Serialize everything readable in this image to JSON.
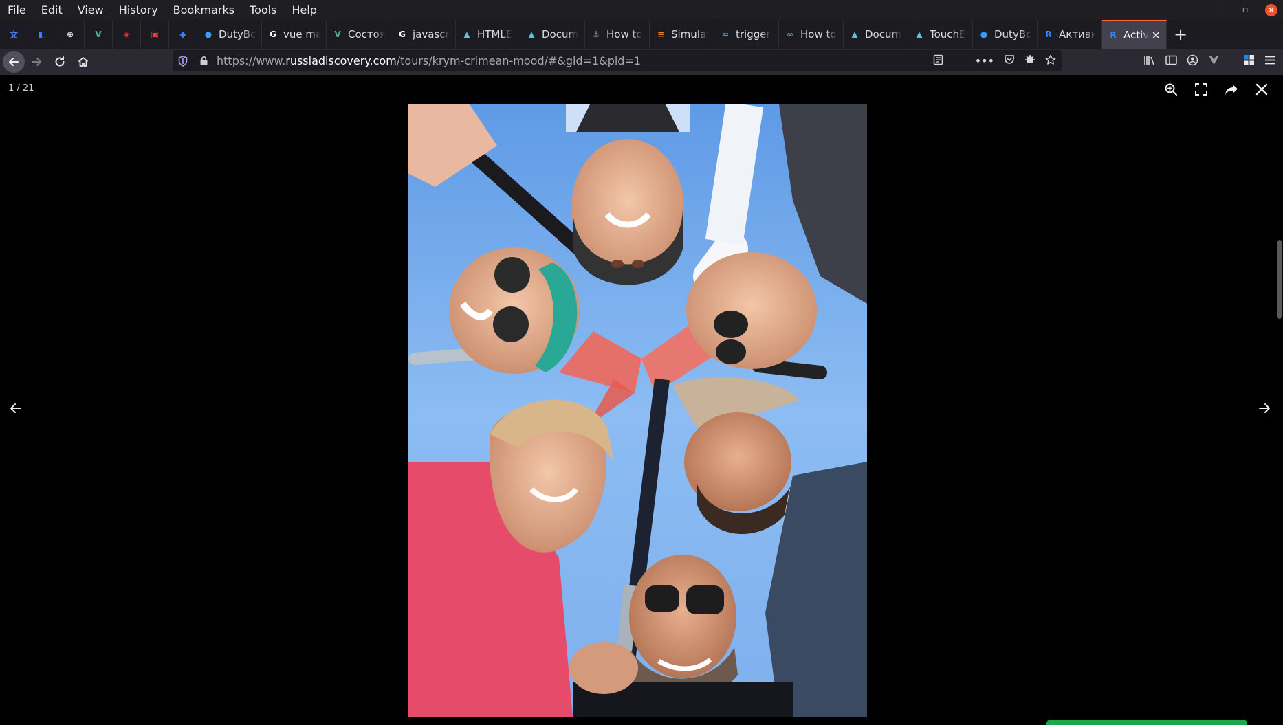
{
  "menu": [
    "File",
    "Edit",
    "View",
    "History",
    "Bookmarks",
    "Tools",
    "Help"
  ],
  "tabs": [
    {
      "type": "pinned",
      "icon": "translate-icon",
      "color": "#4a7fe0"
    },
    {
      "type": "pinned",
      "icon": "bitwarden-icon",
      "color": "#3b82f6"
    },
    {
      "type": "pinned",
      "icon": "globe-icon",
      "color": "#e8e8e8"
    },
    {
      "type": "pinned",
      "icon": "vue-icon",
      "color": "#42b883"
    },
    {
      "type": "pinned",
      "icon": "laravel-icon",
      "color": "#e3342f"
    },
    {
      "type": "pinned",
      "icon": "todoist-icon",
      "color": "#e44332"
    },
    {
      "type": "pinned",
      "icon": "jira-icon",
      "color": "#2684ff"
    },
    {
      "type": "normal",
      "icon": "dutybot-icon",
      "title": "DutyBo",
      "color": "#3b9cf5"
    },
    {
      "type": "normal",
      "icon": "google-icon",
      "title": "vue ma",
      "color": "#ffffff"
    },
    {
      "type": "normal",
      "icon": "vue-icon",
      "title": "Состоя",
      "color": "#42b883"
    },
    {
      "type": "normal",
      "icon": "google-icon",
      "title": "javascri",
      "color": "#ffffff"
    },
    {
      "type": "normal",
      "icon": "mdn-icon",
      "title": "HTMLE",
      "color": "#5ec4e6"
    },
    {
      "type": "normal",
      "icon": "mdn-icon",
      "title": "Docum",
      "color": "#5ec4e6"
    },
    {
      "type": "normal",
      "icon": "anchor-icon",
      "title": "How to",
      "color": "#8a8a8a"
    },
    {
      "type": "normal",
      "icon": "stackoverflow-icon",
      "title": "Simulat",
      "color": "#f48024"
    },
    {
      "type": "normal",
      "icon": "wave-icon",
      "title": "trigger",
      "color": "#4a9cf0"
    },
    {
      "type": "normal",
      "icon": "infinity-icon",
      "title": "How to",
      "color": "#4caf50"
    },
    {
      "type": "normal",
      "icon": "mdn-icon",
      "title": "Docum",
      "color": "#5ec4e6"
    },
    {
      "type": "normal",
      "icon": "mdn-icon",
      "title": "TouchE",
      "color": "#5ec4e6"
    },
    {
      "type": "normal",
      "icon": "dutybot-icon",
      "title": "DutyBo",
      "color": "#3b9cf5"
    },
    {
      "type": "normal",
      "icon": "rd-icon",
      "title": "Активн",
      "color": "#3b82f6"
    },
    {
      "type": "active",
      "icon": "rd-icon",
      "title": "Activ",
      "color": "#3b82f6"
    }
  ],
  "url": {
    "prefix": "https://www.",
    "domain": "russiadiscovery.com",
    "path": "/tours/krym-crimean-mood/#&gid=1&pid=1"
  },
  "gallery": {
    "counter": "1 / 21"
  }
}
